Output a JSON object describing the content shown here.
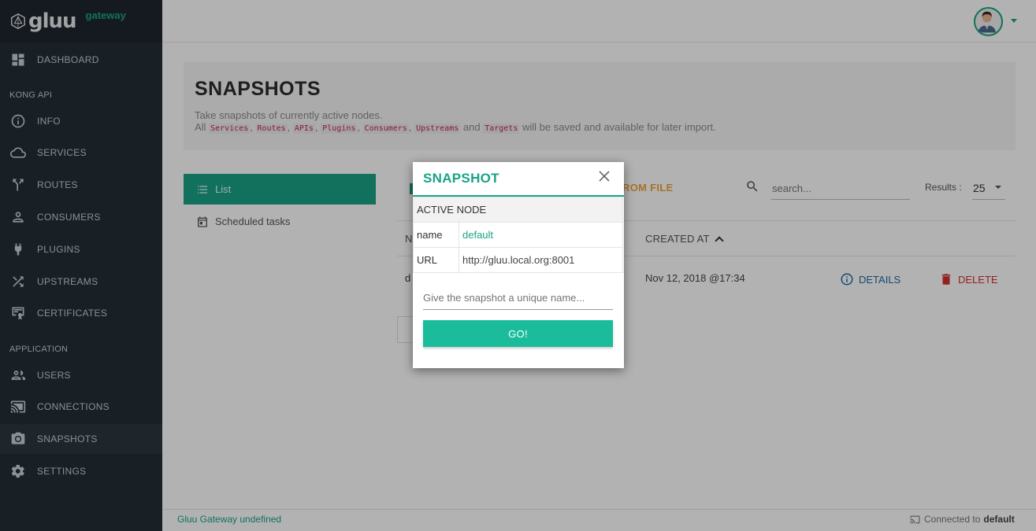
{
  "brand": {
    "logo_text": "gluu",
    "sub_text": "gateway"
  },
  "sidebar": {
    "items": [
      {
        "label": "DASHBOARD",
        "icon": "dashboard-icon"
      },
      {
        "label": "INFO",
        "icon": "info-icon"
      },
      {
        "label": "SERVICES",
        "icon": "cloud-icon"
      },
      {
        "label": "ROUTES",
        "icon": "routes-icon"
      },
      {
        "label": "CONSUMERS",
        "icon": "person-icon"
      },
      {
        "label": "PLUGINS",
        "icon": "plug-icon"
      },
      {
        "label": "UPSTREAMS",
        "icon": "shuffle-icon"
      },
      {
        "label": "CERTIFICATES",
        "icon": "certificate-icon"
      },
      {
        "label": "USERS",
        "icon": "users-icon"
      },
      {
        "label": "CONNECTIONS",
        "icon": "cast-icon"
      },
      {
        "label": "SNAPSHOTS",
        "icon": "camera-icon"
      },
      {
        "label": "SETTINGS",
        "icon": "gear-icon"
      }
    ],
    "sections": {
      "kong_api": "KONG API",
      "application": "APPLICATION"
    },
    "active": "SNAPSHOTS"
  },
  "header": {
    "title": "SNAPSHOTS",
    "desc_line1": "Take snapshots of currently active nodes.",
    "desc_all": "All",
    "codes": [
      "Services",
      "Routes",
      "APIs",
      "Plugins",
      "Consumers",
      "Upstreams",
      "Targets"
    ],
    "sep": ",",
    "and": "and",
    "desc_tail": "will be saved and available for later import."
  },
  "tabs": {
    "list": "List",
    "scheduled": "Scheduled tasks"
  },
  "toolbar": {
    "import_label": "ROM FILE",
    "search_placeholder": "search...",
    "results_label": "Results :",
    "results_value": "25"
  },
  "table": {
    "col_partial": "N",
    "col_created": "CREATED AT",
    "row": {
      "name_partial": "d",
      "created": "Nov 12, 2018 @17:34",
      "details": "DETAILS",
      "delete": "DELETE"
    }
  },
  "modal": {
    "title": "SNAPSHOT",
    "section": "ACTIVE NODE",
    "rows": [
      {
        "key": "name",
        "value": "default"
      },
      {
        "key": "URL",
        "value": "http://gluu.local.org:8001"
      }
    ],
    "input_placeholder": "Give the snapshot a unique name...",
    "go_label": "GO!"
  },
  "footer": {
    "left": "Gluu Gateway undefined",
    "connected_prefix": "Connected to",
    "connected_node": "default"
  },
  "colors": {
    "accent": "#1aa386",
    "sidebar": "#232d35",
    "import": "#f0a23a",
    "delete": "#d32f2f",
    "details": "#1e6aa5"
  }
}
